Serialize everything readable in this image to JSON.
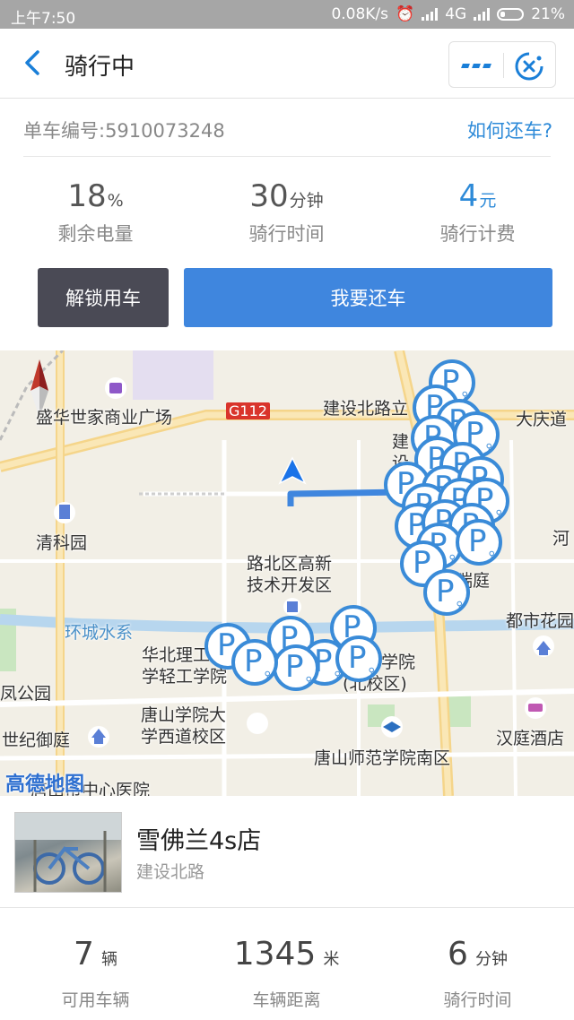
{
  "status_bar": {
    "time": "上午7:50",
    "network_speed": "0.08K/s",
    "network_type": "4G",
    "battery": "21%"
  },
  "nav": {
    "title": "骑行中",
    "back_icon": "chevron-left-icon",
    "more_icon": "more-dots-icon",
    "close_icon": "circle-close-icon"
  },
  "bike": {
    "number_label": "单车编号:5910073248",
    "how_to_return": "如何还车?"
  },
  "ride_stats": [
    {
      "value": "18",
      "unit": "%",
      "label": "剩余电量"
    },
    {
      "value": "30",
      "unit": "分钟",
      "label": "骑行时间"
    },
    {
      "value": "4",
      "unit": "元",
      "label": "骑行计费"
    }
  ],
  "actions": {
    "unlock": "解锁用车",
    "return": "我要还车"
  },
  "map": {
    "labels": {
      "shengh": "盛华世家商业广场",
      "g112": "G112",
      "jianshe": "建设北路立",
      "daqing": "大庆道",
      "jianshe_v": "建设",
      "qingke": "清科园",
      "he": "河",
      "gaoxin1": "路北区高新",
      "gaoxin2": "技术开发区",
      "ruiting": "瑞庭",
      "huancheng": "环城水系",
      "dushi": "都市花园",
      "huabei1": "华北理工",
      "huabei2": "学轻工学院",
      "xueyuan1": "学院",
      "xueyuan2": "(北校区)",
      "gongyuan": "凤公园",
      "tangshan1": "唐山学院大",
      "tangshan2": "学西道校区",
      "shiji": "世纪御庭",
      "hanting": "汉庭酒店",
      "shifan": "唐山师范学院南区",
      "hospital": "唐山市中心医院",
      "logo": "高德地图"
    },
    "route_color": "#3f86de",
    "parking_color": "#3a8bd8"
  },
  "destination": {
    "name": "雪佛兰4s店",
    "address": "建设北路"
  },
  "bike_stats": [
    {
      "value": "7",
      "unit": "辆",
      "label": "可用车辆"
    },
    {
      "value": "1345",
      "unit": "米",
      "label": "车辆距离"
    },
    {
      "value": "6",
      "unit": "分钟",
      "label": "骑行时间"
    }
  ]
}
